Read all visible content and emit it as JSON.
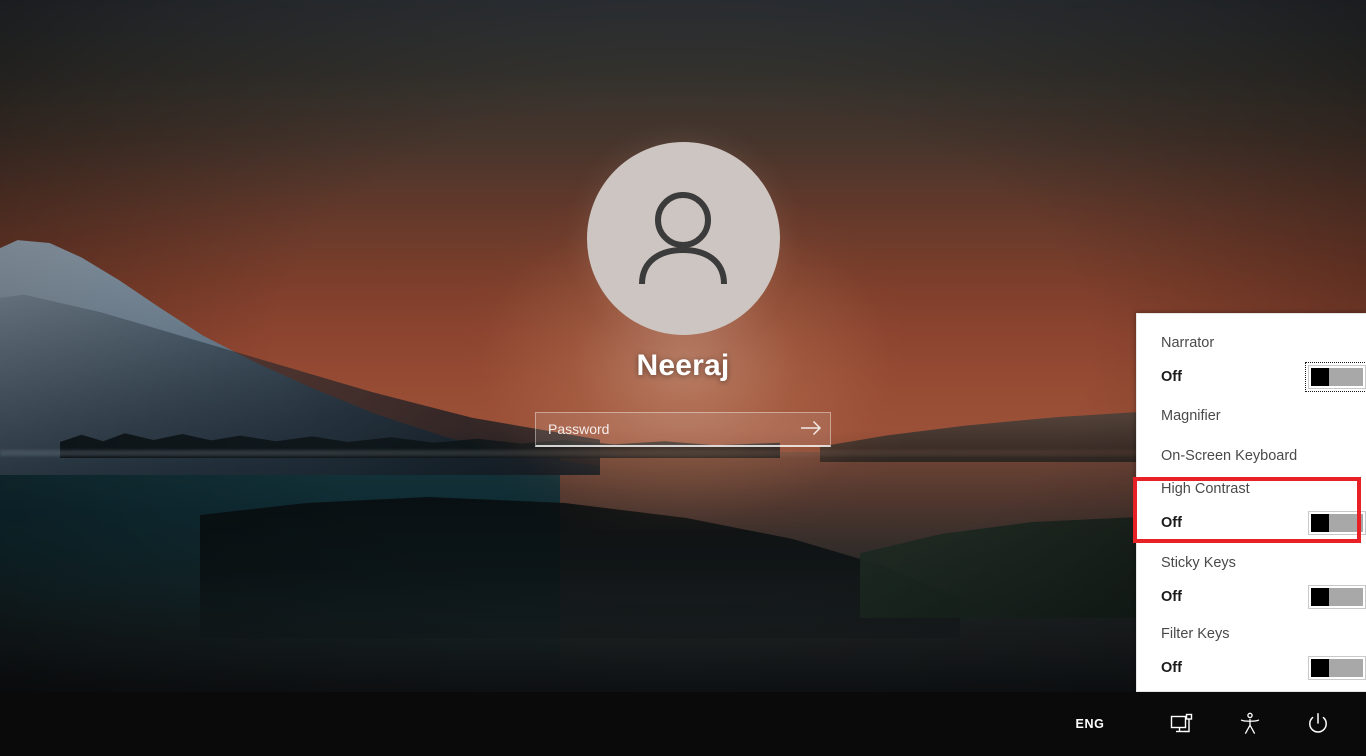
{
  "screen": {
    "kind": "windows-lock-screen",
    "background_description": "Sunset mountain lake wallpaper",
    "colors": {
      "annotation_red": "#e82127",
      "flyout_background": "#ffffff",
      "taskbar_background": "#0a0a0b",
      "toggle_track": "#a8a8a8",
      "toggle_thumb": "#000000",
      "avatar_circle": "#cdc5c1"
    }
  },
  "login": {
    "avatar_icon": "user-avatar-icon",
    "username": "Neeraj",
    "password": {
      "placeholder": "Password",
      "value": "",
      "submit_icon": "arrow-right-icon"
    }
  },
  "ease_of_access_flyout": {
    "items": [
      {
        "label": "Narrator",
        "state": "Off",
        "has_toggle": true,
        "focused": true
      },
      {
        "label": "Magnifier",
        "state": "",
        "has_toggle": false,
        "focused": false
      },
      {
        "label": "On-Screen Keyboard",
        "state": "",
        "has_toggle": false,
        "focused": false
      },
      {
        "label": "High Contrast",
        "state": "Off",
        "has_toggle": true,
        "focused": false
      },
      {
        "label": "Sticky Keys",
        "state": "Off",
        "has_toggle": true,
        "focused": false
      },
      {
        "label": "Filter Keys",
        "state": "Off",
        "has_toggle": true,
        "focused": false
      }
    ]
  },
  "annotation": {
    "target": "High Contrast",
    "color": "#e82127"
  },
  "taskbar": {
    "language": "ENG",
    "icons": [
      {
        "name": "network-icon",
        "label": "Network"
      },
      {
        "name": "ease-of-access-icon",
        "label": "Ease of access"
      },
      {
        "name": "power-icon",
        "label": "Power"
      }
    ]
  }
}
